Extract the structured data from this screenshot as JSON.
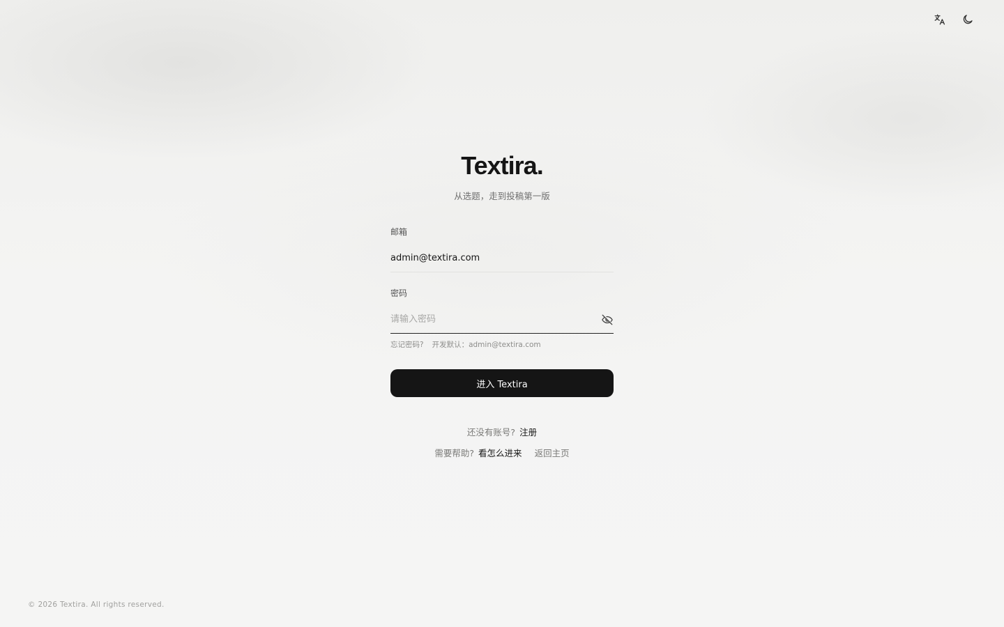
{
  "brand": {
    "name": "Textira",
    "dot": ".",
    "tagline": "从选题，走到投稿第一版"
  },
  "topbar": {
    "translate_icon": "translate-icon",
    "theme_icon": "moon-icon"
  },
  "form": {
    "email": {
      "label": "邮箱",
      "value": "admin@textira.com"
    },
    "password": {
      "label": "密码",
      "value": "",
      "placeholder": "请输入密码",
      "toggle_icon": "eye-off-icon"
    },
    "forgot_label": "忘记密码?",
    "dev_default": "开发默认：admin@textira.com",
    "submit_label": "进入 Textira"
  },
  "links": {
    "no_account_text": "还没有账号?",
    "register_label": "注册",
    "help_text": "需要帮助?",
    "how_to_enter_label": "看怎么进来",
    "home_label": "返回主页"
  },
  "footer": {
    "copyright": "© 2026 Textira. All rights reserved."
  },
  "colors": {
    "background": "#f3f3f2",
    "primary": "#151515",
    "muted": "#7a7a78"
  }
}
